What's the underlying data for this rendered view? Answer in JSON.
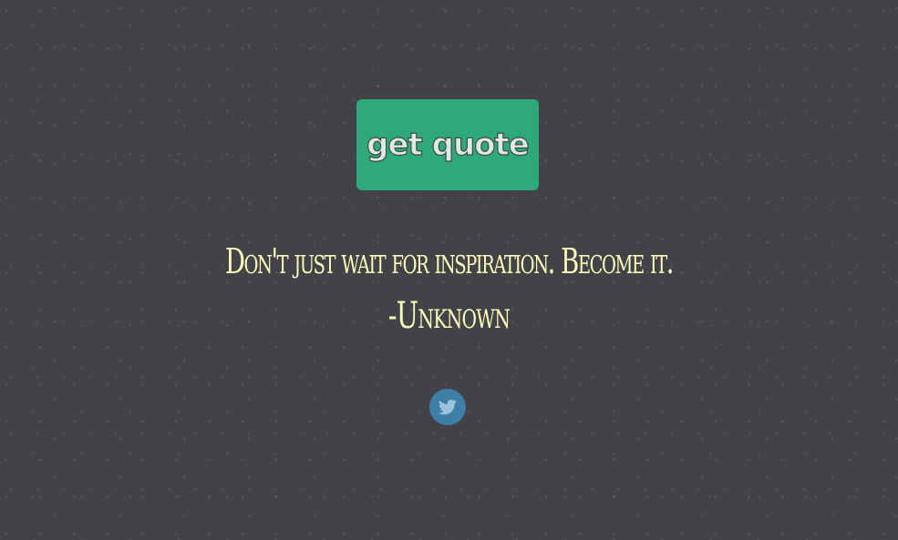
{
  "button": {
    "label": "get quote"
  },
  "quote": {
    "text": "Don't just wait for inspiration. Become it.",
    "author": "-Unknown"
  },
  "share": {
    "icon": "twitter-bird-icon"
  },
  "colors": {
    "background": "#434249",
    "button": "#2eaa7a",
    "quote_text": "#fbffb8",
    "twitter": "#3d7fa6"
  }
}
